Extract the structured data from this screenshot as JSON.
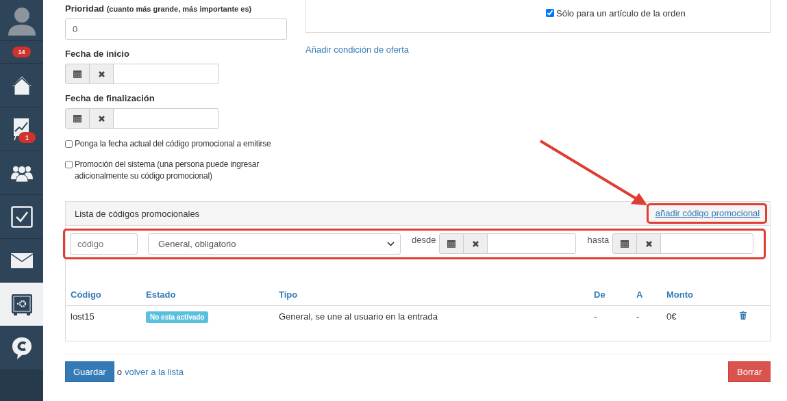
{
  "sidebar": {
    "items": [
      {
        "kind": "avatar",
        "selected": false
      },
      {
        "kind": "counter",
        "selected": false,
        "badge": "14"
      },
      {
        "kind": "home",
        "selected": false
      },
      {
        "kind": "chart",
        "selected": false,
        "badge": "1"
      },
      {
        "kind": "users",
        "selected": false
      },
      {
        "kind": "tasks",
        "selected": false
      },
      {
        "kind": "mail",
        "selected": false
      },
      {
        "kind": "safe",
        "selected": true
      },
      {
        "kind": "chat",
        "selected": false
      }
    ]
  },
  "form": {
    "priority": {
      "label": "Prioridad",
      "hint": "(cuanto más grande, más importante es)",
      "value": "0"
    },
    "start_date": {
      "label": "Fecha de inicio"
    },
    "end_date": {
      "label": "Fecha de finalización"
    },
    "checkboxes": [
      {
        "label": "Ponga la fecha actual del código promocional a emitirse",
        "checked": false
      },
      {
        "label": "Promoción del sistema (una persona puede ingresar adicionalmente su código promocional)",
        "checked": false
      }
    ]
  },
  "offer_condition": {
    "checkbox": {
      "label": "Sólo para un artículo de la orden",
      "checked": true
    },
    "add_link": "Añadir condición de oferta"
  },
  "promo_panel": {
    "title": "Lista de códigos promocionales",
    "add_link": "añadir código promocional",
    "filter": {
      "code_placeholder": "código",
      "type_value": "General, obligatorio",
      "from_label": "desde",
      "to_label": "hasta"
    },
    "table": {
      "columns": [
        "Código",
        "Estado",
        "Tipo",
        "De",
        "A",
        "Monto"
      ],
      "rows": [
        {
          "code": "lost15",
          "status": "No esta activado",
          "type": "General, se une al usuario en la entrada",
          "from": "-",
          "to": "-",
          "amount": "0€"
        }
      ]
    }
  },
  "actions": {
    "save": "Guardar",
    "back_prefix": "o",
    "back_link": "volver a la lista",
    "delete": "Borrar"
  }
}
